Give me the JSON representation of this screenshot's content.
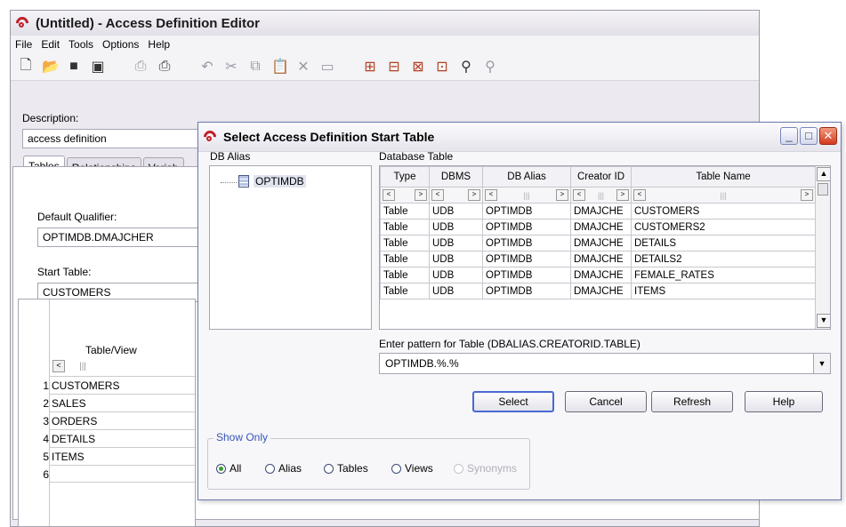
{
  "main_window": {
    "title": "(Untitled) - Access Definition Editor",
    "menu": [
      "File",
      "Edit",
      "Tools",
      "Options",
      "Help"
    ],
    "description_label": "Description:",
    "description_value": "access definition",
    "tabs": [
      "Tables",
      "Relationships",
      "Variab"
    ],
    "default_qualifier_label": "Default Qualifier:",
    "default_qualifier_value": "OPTIMDB.DMAJCHER",
    "start_table_label": "Start Table:",
    "start_table_value": "CUSTOMERS",
    "grid_header": "Table/View",
    "rows": [
      {
        "num": "1",
        "name": "CUSTOMERS"
      },
      {
        "num": "2",
        "name": "SALES"
      },
      {
        "num": "3",
        "name": "ORDERS"
      },
      {
        "num": "4",
        "name": "DETAILS"
      },
      {
        "num": "5",
        "name": "ITEMS"
      },
      {
        "num": "6",
        "name": ""
      }
    ]
  },
  "dialog": {
    "title": "Select Access Definition Start Table",
    "db_alias_label": "DB Alias",
    "tree_node": "OPTIMDB",
    "database_table_label": "Database Table",
    "columns": [
      "Type",
      "DBMS",
      "DB Alias",
      "Creator ID",
      "Table Name"
    ],
    "rows": [
      [
        "Table",
        "UDB",
        "OPTIMDB",
        "DMAJCHE",
        "CUSTOMERS"
      ],
      [
        "Table",
        "UDB",
        "OPTIMDB",
        "DMAJCHE",
        "CUSTOMERS2"
      ],
      [
        "Table",
        "UDB",
        "OPTIMDB",
        "DMAJCHE",
        "DETAILS"
      ],
      [
        "Table",
        "UDB",
        "OPTIMDB",
        "DMAJCHE",
        "DETAILS2"
      ],
      [
        "Table",
        "UDB",
        "OPTIMDB",
        "DMAJCHE",
        "FEMALE_RATES"
      ],
      [
        "Table",
        "UDB",
        "OPTIMDB",
        "DMAJCHE",
        "ITEMS"
      ]
    ],
    "pattern_label": "Enter pattern for Table (DBALIAS.CREATORID.TABLE)",
    "pattern_value": "OPTIMDB.%.%",
    "buttons": {
      "select": "Select",
      "cancel": "Cancel",
      "refresh": "Refresh",
      "help": "Help"
    },
    "show_only": {
      "legend": "Show Only",
      "all": "All",
      "alias": "Alias",
      "tables": "Tables",
      "views": "Views",
      "synonyms": "Synonyms",
      "selected": "All"
    }
  },
  "colors": {
    "accent": "#3456b8",
    "brand": "#c0202a"
  }
}
